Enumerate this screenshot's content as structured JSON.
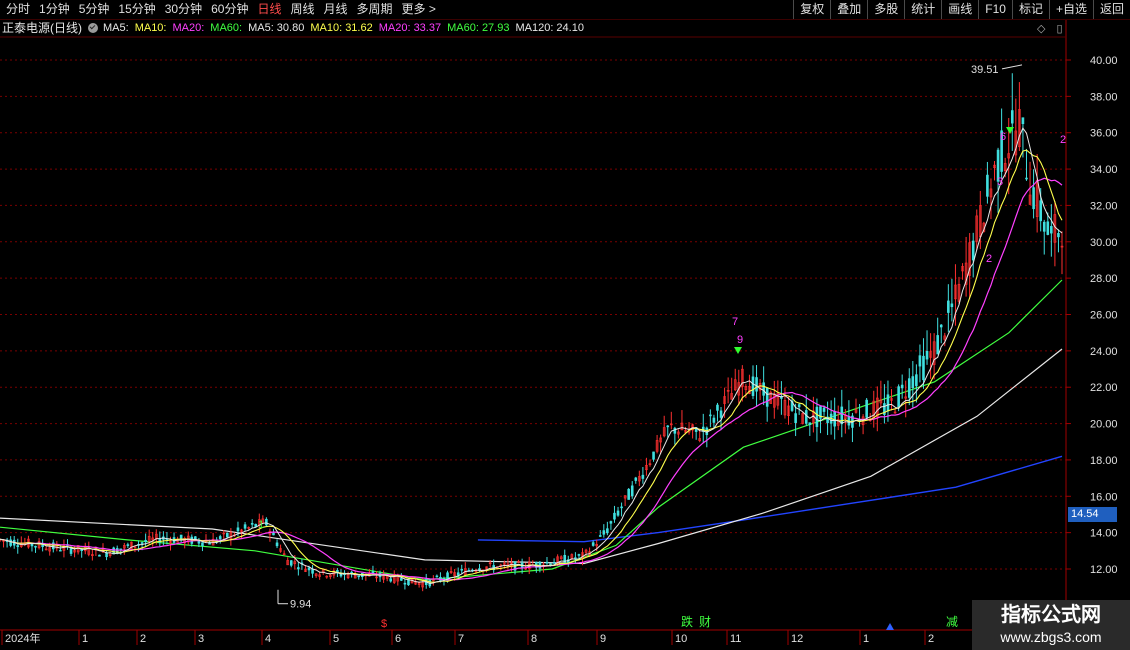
{
  "period_tabs": [
    "分时",
    "1分钟",
    "5分钟",
    "15分钟",
    "30分钟",
    "60分钟",
    "日线",
    "周线",
    "月线",
    "多周期",
    "更多 >"
  ],
  "active_tab": "日线",
  "toolbar": [
    "复权",
    "叠加",
    "多股",
    "统计",
    "画线",
    "F10",
    "标记",
    "+自选",
    "返回"
  ],
  "legend": {
    "title": "正泰电源(日线)",
    "ma_labels": [
      {
        "text": "MA5:",
        "color": "#e8e8e8"
      },
      {
        "text": "MA10:",
        "color": "#ffff4d"
      },
      {
        "text": "MA20:",
        "color": "#ff40ff"
      },
      {
        "text": "MA60:",
        "color": "#40ff40"
      },
      {
        "text": "MA5: 30.80",
        "color": "#e8e8e8"
      },
      {
        "text": "MA10: 31.62",
        "color": "#ffff4d"
      },
      {
        "text": "MA20: 33.37",
        "color": "#ff40ff"
      },
      {
        "text": "MA60: 27.93",
        "color": "#40ff40"
      },
      {
        "text": "MA120: 24.10",
        "color": "#e8e8e8"
      }
    ]
  },
  "chart_icons": [
    "◇",
    "▯"
  ],
  "price_axis": {
    "ticks": [
      "40.00",
      "38.00",
      "36.00",
      "34.00",
      "32.00",
      "30.00",
      "28.00",
      "26.00",
      "24.00",
      "22.00",
      "20.00",
      "18.00",
      "16.00",
      "14.00",
      "12.00"
    ],
    "current_price": "14.54"
  },
  "annotations": {
    "high_label": "39.51",
    "low_label": "9.94",
    "seq_labels": [
      "7",
      "9",
      "6",
      "2",
      "3",
      "2",
      "1"
    ],
    "signal_labels": [
      "跌",
      "财",
      "减"
    ]
  },
  "date_axis": {
    "labels": [
      "2024年",
      "1",
      "2",
      "3",
      "4",
      "5",
      "6",
      "7",
      "8",
      "9",
      "10",
      "11",
      "12",
      "1",
      "2",
      "3"
    ]
  },
  "watermark": {
    "line1": "指标公式网",
    "line2": "www.zbgs3.com"
  },
  "chart_data": {
    "type": "line",
    "title": "正泰电源(日线)",
    "ylim": [
      11,
      41
    ],
    "y_ticks": [
      40,
      38,
      36,
      34,
      32,
      30,
      28,
      26,
      24,
      22,
      20,
      18,
      16,
      14,
      12
    ],
    "x_labels": [
      "2024年",
      "1",
      "2",
      "3",
      "4",
      "5",
      "6",
      "7",
      "8",
      "9",
      "10",
      "11",
      "12",
      "1",
      "2",
      "3"
    ],
    "series": [
      {
        "name": "MA5",
        "color": "#e8e8e8",
        "last": 30.8
      },
      {
        "name": "MA10",
        "color": "#ffff4d",
        "last": 31.62
      },
      {
        "name": "MA20",
        "color": "#ff40ff",
        "last": 33.37
      },
      {
        "name": "MA60",
        "color": "#40ff40",
        "last": 27.93
      },
      {
        "name": "MA120",
        "color": "#e8e8e8",
        "last": 24.1
      }
    ],
    "key_points": {
      "high": 39.51,
      "low": 9.94,
      "current": 14.54
    },
    "ma_paths": {
      "MA60": [
        [
          0,
          14.3
        ],
        [
          0.12,
          13.6
        ],
        [
          0.24,
          13.0
        ],
        [
          0.4,
          11.4
        ],
        [
          0.52,
          12.0
        ],
        [
          0.58,
          13.3
        ],
        [
          0.62,
          15.4
        ],
        [
          0.7,
          18.7
        ],
        [
          0.8,
          20.7
        ],
        [
          0.88,
          22.3
        ],
        [
          0.95,
          25.0
        ],
        [
          1.0,
          27.9
        ]
      ],
      "MA120": [
        [
          0,
          14.8
        ],
        [
          0.2,
          14.2
        ],
        [
          0.4,
          12.5
        ],
        [
          0.55,
          12.3
        ],
        [
          0.62,
          13.4
        ],
        [
          0.72,
          15.1
        ],
        [
          0.82,
          17.1
        ],
        [
          0.92,
          20.4
        ],
        [
          1.0,
          24.1
        ]
      ],
      "MA250": [
        [
          0.45,
          13.6
        ],
        [
          0.55,
          13.5
        ],
        [
          0.62,
          14.0
        ],
        [
          0.7,
          14.7
        ],
        [
          0.8,
          15.6
        ],
        [
          0.9,
          16.5
        ],
        [
          1.0,
          18.2
        ]
      ]
    },
    "close_path": [
      [
        0,
        13.6
      ],
      [
        0.05,
        13.2
      ],
      [
        0.1,
        12.9
      ],
      [
        0.15,
        13.7
      ],
      [
        0.2,
        13.5
      ],
      [
        0.25,
        14.6
      ],
      [
        0.27,
        12.5
      ],
      [
        0.3,
        11.8
      ],
      [
        0.36,
        11.6
      ],
      [
        0.4,
        11.2
      ],
      [
        0.45,
        12.1
      ],
      [
        0.5,
        12.2
      ],
      [
        0.55,
        12.7
      ],
      [
        0.57,
        14.0
      ],
      [
        0.6,
        16.8
      ],
      [
        0.63,
        19.8
      ],
      [
        0.66,
        19.4
      ],
      [
        0.7,
        22.5
      ],
      [
        0.72,
        21.6
      ],
      [
        0.76,
        20.3
      ],
      [
        0.8,
        20.4
      ],
      [
        0.84,
        21.0
      ],
      [
        0.88,
        24.0
      ],
      [
        0.9,
        26.8
      ],
      [
        0.92,
        30.5
      ],
      [
        0.94,
        34.5
      ],
      [
        0.96,
        36.5
      ],
      [
        0.97,
        33.3
      ],
      [
        0.99,
        30.0
      ],
      [
        1.0,
        31.0
      ]
    ]
  }
}
